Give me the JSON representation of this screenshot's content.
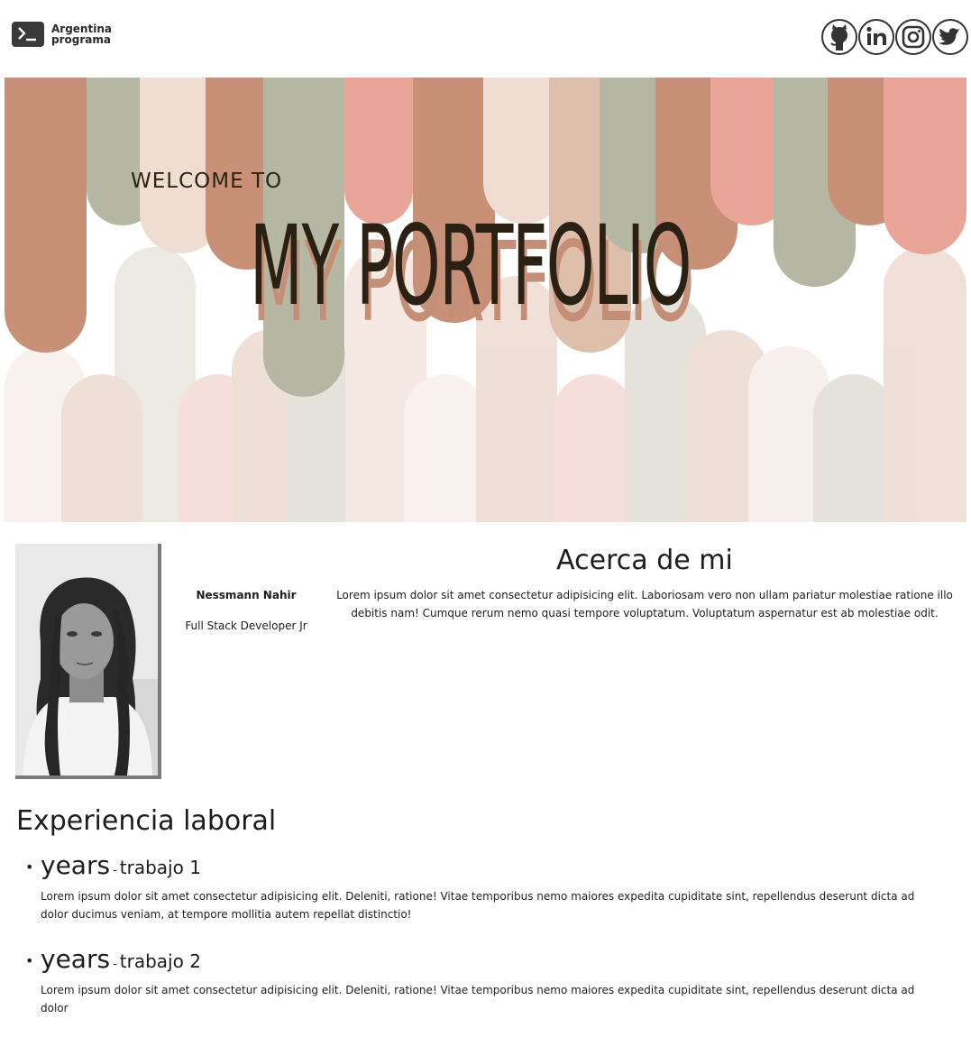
{
  "header": {
    "logo_line1": "Argentina",
    "logo_line2": "programa",
    "social": [
      "github-icon",
      "linkedin-icon",
      "instagram-icon",
      "twitter-icon"
    ]
  },
  "hero": {
    "welcome": "WELCOME TO",
    "title": "MY PORTFOLIO"
  },
  "profile": {
    "name": "Nessmann Nahir",
    "role": "Full Stack Developer Jr"
  },
  "about": {
    "title": "Acerca de mi",
    "text": "Lorem ipsum dolor sit amet consectetur adipisicing elit. Laboriosam vero non ullam pariatur molestiae ratione illo debitis nam! Cumque rerum nemo quasi tempore voluptatum. Voluptatum aspernatur est ab molestiae odit."
  },
  "experience": {
    "title": "Experiencia laboral",
    "items": [
      {
        "years": "years",
        "sep": "-",
        "job": "trabajo 1",
        "text": "Lorem ipsum dolor sit amet consectetur adipisicing elit. Deleniti, ratione! Vitae temporibus nemo maiores expedita cupiditate sint, repellendus deserunt dicta ad dolor ducimus veniam, at tempore mollitia autem repellat distinctio!"
      },
      {
        "years": "years",
        "sep": "-",
        "job": "trabajo 2",
        "text": "Lorem ipsum dolor sit amet consectetur adipisicing elit. Deleniti, ratione! Vitae temporibus nemo maiores expedita cupiditate sint, repellendus deserunt dicta ad dolor"
      }
    ]
  },
  "colors": {
    "terracotta": "#c99078",
    "sage": "#b6b7a3",
    "blush": "#e8a598",
    "sand": "#ddbfab",
    "cream": "#efddd3",
    "title_dark": "#2a2114",
    "title_shadow": "#c58f77"
  }
}
